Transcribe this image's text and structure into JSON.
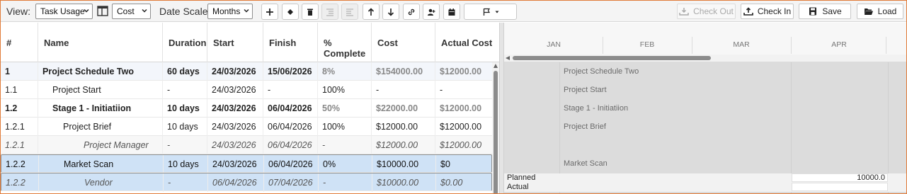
{
  "toolbar": {
    "view_label": "View:",
    "view_select": "Task Usage",
    "cost_select": "Cost",
    "date_scale_label": "Date Scale:",
    "date_scale_select": "Months",
    "check_out": "Check Out",
    "check_in": "Check In",
    "save": "Save",
    "load": "Load"
  },
  "grid": {
    "headers": [
      "#",
      "Name",
      "Duration",
      "Start",
      "Finish",
      "% Complete",
      "Cost",
      "Actual Cost"
    ],
    "rows": [
      {
        "id": "1",
        "name": "Project Schedule Two",
        "duration": "60 days",
        "start": "24/03/2026",
        "finish": "15/06/2026",
        "pct": "8%",
        "cost": "$154000.00",
        "actual": "$12000.00"
      },
      {
        "id": "1.1",
        "name": "Project Start",
        "duration": "-",
        "start": "24/03/2026",
        "finish": "-",
        "pct": "100%",
        "cost": "-",
        "actual": "-"
      },
      {
        "id": "1.2",
        "name": "Stage 1 - Initiatiion",
        "duration": "10 days",
        "start": "24/03/2026",
        "finish": "06/04/2026",
        "pct": "50%",
        "cost": "$22000.00",
        "actual": "$12000.00"
      },
      {
        "id": "1.2.1",
        "name": "Project Brief",
        "duration": "10 days",
        "start": "24/03/2026",
        "finish": "06/04/2026",
        "pct": "100%",
        "cost": "$12000.00",
        "actual": "$12000.00"
      },
      {
        "id": "1.2.1",
        "name": "Project Manager",
        "duration": "-",
        "start": "24/03/2026",
        "finish": "06/04/2026",
        "pct": "-",
        "cost": "$12000.00",
        "actual": "$12000.00"
      },
      {
        "id": "1.2.2",
        "name": "Market Scan",
        "duration": "10 days",
        "start": "24/03/2026",
        "finish": "06/04/2026",
        "pct": "0%",
        "cost": "$10000.00",
        "actual": "$0"
      },
      {
        "id": "1.2.2",
        "name": "Vendor",
        "duration": "-",
        "start": "06/04/2026",
        "finish": "07/04/2026",
        "pct": "-",
        "cost": "$10000.00",
        "actual": "$0.00"
      }
    ]
  },
  "gantt": {
    "months": [
      "JAN",
      "FEB",
      "MAR",
      "APR"
    ],
    "task_labels": [
      "Project Schedule Two",
      "Project Start",
      "Stage 1 - Initiatiion",
      "Project Brief",
      "",
      "Market Scan"
    ],
    "planned_label": "Planned",
    "actual_label": "Actual",
    "planned_value": "10000.0",
    "actual_value": ""
  },
  "colors": {
    "selected_row": "#cfe2f6",
    "frame_border": "#e07b39",
    "gantt_bg": "#dcdcdc"
  }
}
